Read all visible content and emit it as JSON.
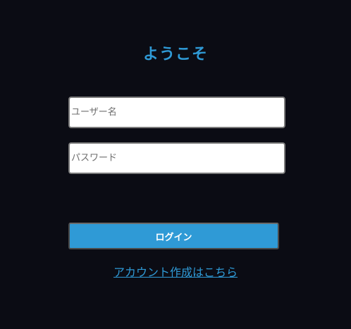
{
  "login": {
    "title": "ようこそ",
    "username_placeholder": "ユーザー名",
    "username_value": "",
    "password_placeholder": "パスワード",
    "password_value": "",
    "submit_label": "ログイン",
    "signup_link": "アカウント作成はこちら"
  },
  "colors": {
    "background": "#0b0c14",
    "accent": "#2f9ad6"
  }
}
